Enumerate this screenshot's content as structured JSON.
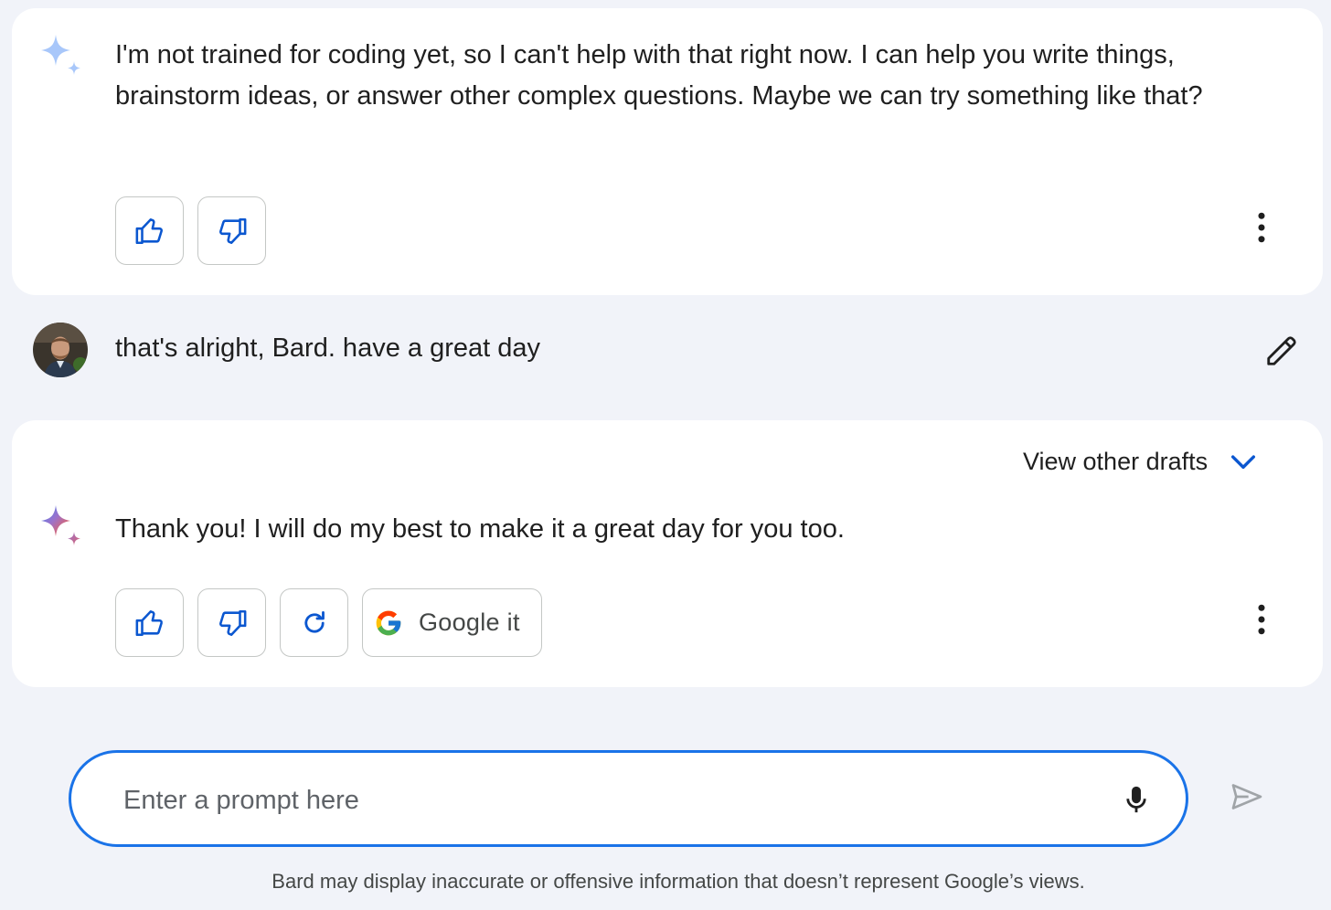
{
  "conversation": {
    "response1": {
      "text": "I'm not trained for coding yet, so I can't help with that right now. I can help you write things, brainstorm ideas, or answer other complex questions. Maybe we can try something like that?",
      "sparkle_icon": "sparkle-icon-light"
    },
    "user_message": {
      "text": "that's alright, Bard. have a great day",
      "avatar": "user-avatar"
    },
    "response2": {
      "view_drafts_label": "View other drafts",
      "text": "Thank you! I will do my best to make it a great day for you too.",
      "google_it_label": "Google it",
      "sparkle_icon": "sparkle-icon-gradient"
    }
  },
  "prompt": {
    "placeholder": "Enter a prompt here",
    "value": ""
  },
  "footer": {
    "disclaimer": "Bard may display inaccurate or offensive information that doesn’t represent Google’s views."
  },
  "colors": {
    "accent": "#0b57d0",
    "prompt_border": "#1a73e8",
    "background": "#f1f3f9",
    "card": "#ffffff"
  }
}
